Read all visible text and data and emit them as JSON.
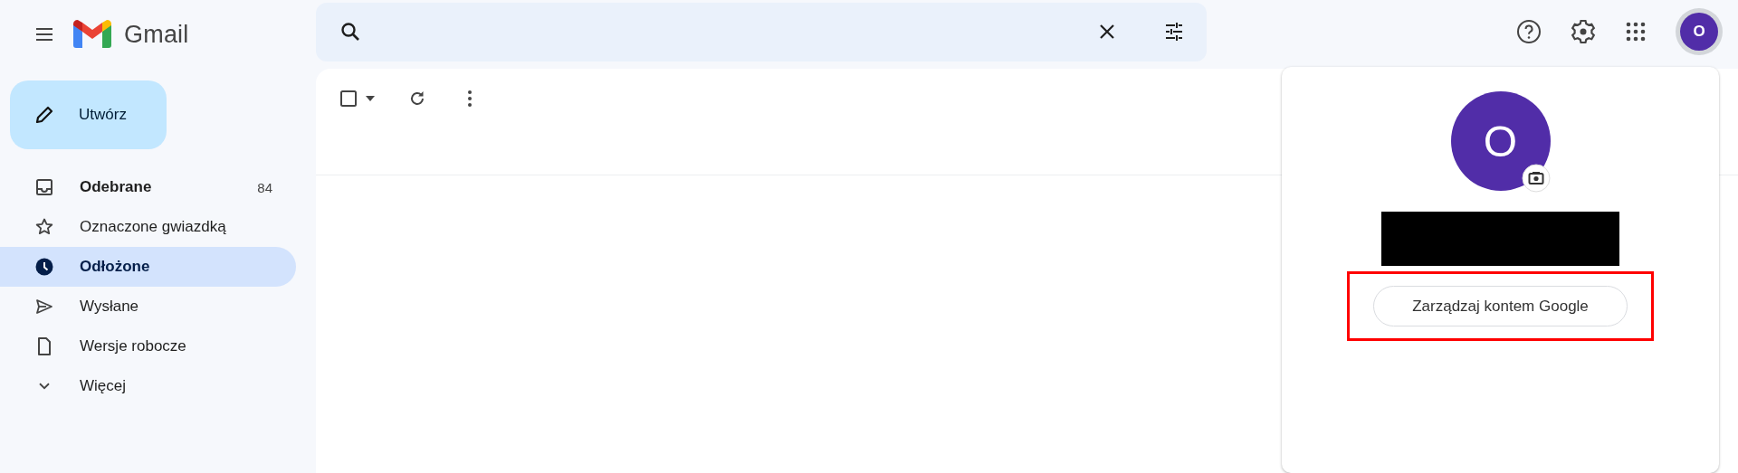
{
  "header": {
    "app_name": "Gmail",
    "avatar_letter": "O"
  },
  "compose": {
    "label": "Utwórz"
  },
  "sidebar": {
    "items": [
      {
        "kind": "inbox",
        "label": "Odebrane",
        "count": "84",
        "unread": true,
        "selected": false
      },
      {
        "kind": "star",
        "label": "Oznaczone gwiazdką",
        "unread": false,
        "selected": false
      },
      {
        "kind": "clock",
        "label": "Odłożone",
        "unread": false,
        "selected": true
      },
      {
        "kind": "sent",
        "label": "Wysłane",
        "unread": false,
        "selected": false
      },
      {
        "kind": "draft",
        "label": "Wersje robocze",
        "unread": false,
        "selected": false
      },
      {
        "kind": "more",
        "label": "Więcej",
        "unread": false,
        "selected": false
      }
    ]
  },
  "account_menu": {
    "avatar_letter": "O",
    "name_redacted": true,
    "manage_button": {
      "label": "Zarządzaj kontem Google",
      "highlighted": true
    }
  }
}
